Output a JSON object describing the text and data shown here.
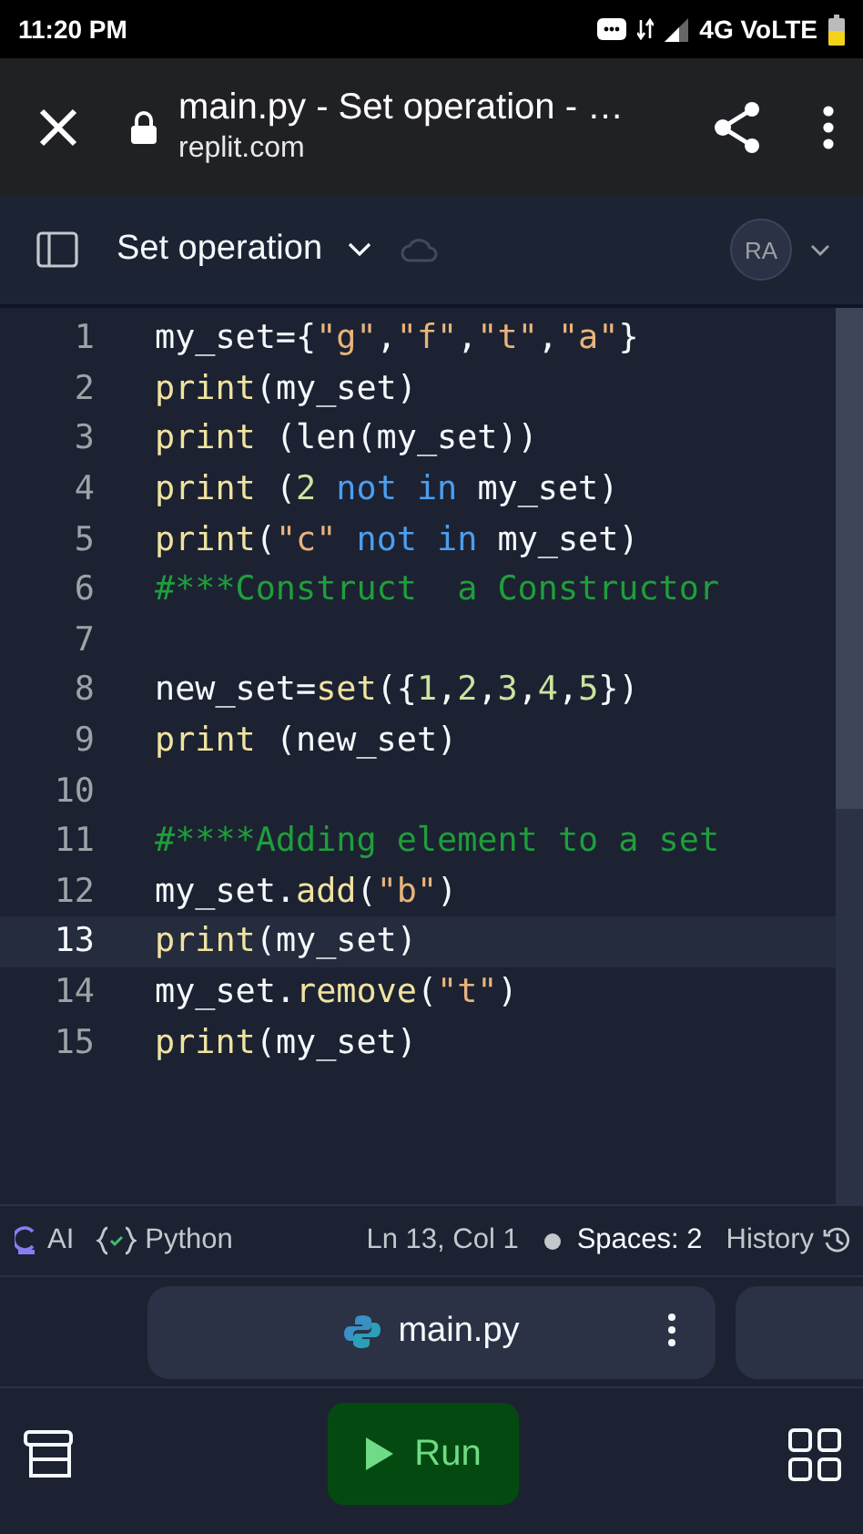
{
  "status_bar": {
    "time": "11:20 PM",
    "network": "4G VoLTE"
  },
  "browser": {
    "title": "main.py - Set operation - …",
    "url": "replit.com"
  },
  "repl_header": {
    "project": "Set operation",
    "avatar": "RA"
  },
  "editor": {
    "lines": [
      {
        "number": "1",
        "current": false,
        "tokens": [
          {
            "text": "my_set={",
            "kind": "plain"
          },
          {
            "text": "\"g\"",
            "kind": "string"
          },
          {
            "text": ",",
            "kind": "plain"
          },
          {
            "text": "\"f\"",
            "kind": "string"
          },
          {
            "text": ",",
            "kind": "plain"
          },
          {
            "text": "\"t\"",
            "kind": "string"
          },
          {
            "text": ",",
            "kind": "plain"
          },
          {
            "text": "\"a\"",
            "kind": "string"
          },
          {
            "text": "}",
            "kind": "plain"
          }
        ]
      },
      {
        "number": "2",
        "current": false,
        "tokens": [
          {
            "text": "print",
            "kind": "function"
          },
          {
            "text": "(my_set)",
            "kind": "plain"
          }
        ]
      },
      {
        "number": "3",
        "current": false,
        "tokens": [
          {
            "text": "print",
            "kind": "function"
          },
          {
            "text": " (len(my_set))",
            "kind": "plain"
          }
        ]
      },
      {
        "number": "4",
        "current": false,
        "tokens": [
          {
            "text": "print",
            "kind": "function"
          },
          {
            "text": " (",
            "kind": "plain"
          },
          {
            "text": "2",
            "kind": "number"
          },
          {
            "text": " not",
            "kind": "keyword"
          },
          {
            "text": " in",
            "kind": "keyword"
          },
          {
            "text": " my_set)",
            "kind": "plain"
          }
        ]
      },
      {
        "number": "5",
        "current": false,
        "tokens": [
          {
            "text": "print",
            "kind": "function"
          },
          {
            "text": "(",
            "kind": "plain"
          },
          {
            "text": "\"c\"",
            "kind": "string"
          },
          {
            "text": " not",
            "kind": "keyword"
          },
          {
            "text": " in",
            "kind": "keyword"
          },
          {
            "text": " my_set)",
            "kind": "plain"
          }
        ]
      },
      {
        "number": "6",
        "current": false,
        "tokens": [
          {
            "text": "#***Construct  a Constructor",
            "kind": "comment"
          }
        ]
      },
      {
        "number": "7",
        "current": false
      },
      {
        "number": "8",
        "current": false,
        "tokens": [
          {
            "text": "new_set=",
            "kind": "plain"
          },
          {
            "text": "set",
            "kind": "function"
          },
          {
            "text": "({",
            "kind": "plain"
          },
          {
            "text": "1",
            "kind": "number"
          },
          {
            "text": ",",
            "kind": "plain"
          },
          {
            "text": "2",
            "kind": "number"
          },
          {
            "text": ",",
            "kind": "plain"
          },
          {
            "text": "3",
            "kind": "number"
          },
          {
            "text": ",",
            "kind": "plain"
          },
          {
            "text": "4",
            "kind": "number"
          },
          {
            "text": ",",
            "kind": "plain"
          },
          {
            "text": "5",
            "kind": "number"
          },
          {
            "text": "})",
            "kind": "plain"
          }
        ]
      },
      {
        "number": "9",
        "current": false,
        "tokens": [
          {
            "text": "print",
            "kind": "function"
          },
          {
            "text": " (new_set)",
            "kind": "plain"
          }
        ]
      },
      {
        "number": "10",
        "current": false
      },
      {
        "number": "11",
        "current": false,
        "tokens": [
          {
            "text": "#****Adding element to a set",
            "kind": "comment"
          }
        ]
      },
      {
        "number": "12",
        "current": false,
        "tokens": [
          {
            "text": "my_set.",
            "kind": "plain"
          },
          {
            "text": "add",
            "kind": "function"
          },
          {
            "text": "(",
            "kind": "plain"
          },
          {
            "text": "\"b\"",
            "kind": "string"
          },
          {
            "text": ")",
            "kind": "plain"
          }
        ]
      },
      {
        "number": "13",
        "current": true,
        "tokens": [
          {
            "text": "print",
            "kind": "function"
          },
          {
            "text": "(my_set)",
            "kind": "plain"
          }
        ]
      },
      {
        "number": "14",
        "current": false,
        "tokens": [
          {
            "text": "my_set.",
            "kind": "plain"
          },
          {
            "text": "remove",
            "kind": "function"
          },
          {
            "text": "(",
            "kind": "plain"
          },
          {
            "text": "\"t\"",
            "kind": "string"
          },
          {
            "text": ")",
            "kind": "plain"
          }
        ]
      },
      {
        "number": "15",
        "current": false,
        "tokens": [
          {
            "text": "print",
            "kind": "function"
          },
          {
            "text": "(my_set)",
            "kind": "plain"
          }
        ]
      }
    ]
  },
  "editor_status": {
    "ai": "AI",
    "language": "Python",
    "cursor": "Ln 13, Col 1",
    "indent": "Spaces: 2",
    "history": "History"
  },
  "file_tab": {
    "name": "main.py"
  },
  "run_button": {
    "label": "Run"
  }
}
